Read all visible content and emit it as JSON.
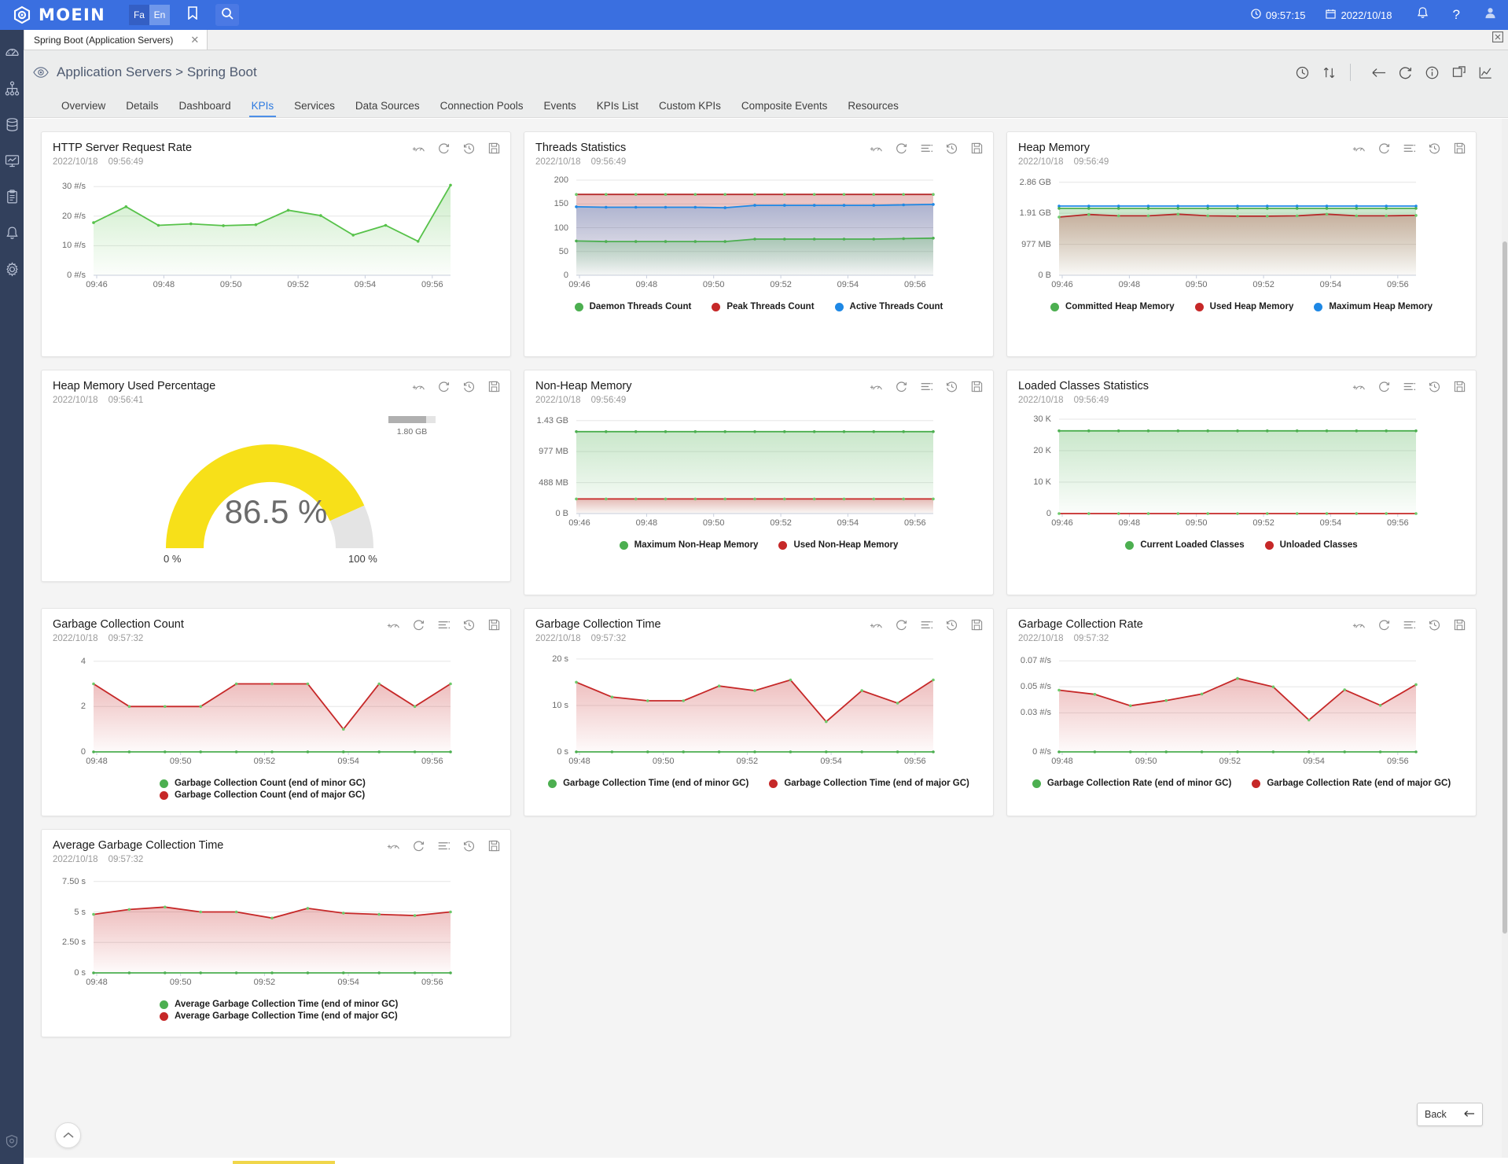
{
  "topbar": {
    "brand": "MOEIN",
    "lang_fa": "Fa",
    "lang_en": "En",
    "bookmark_icon": "bookmark-icon",
    "search_icon": "search-icon",
    "clock_time": "09:57:15",
    "calendar_date": "2022/10/18",
    "bell_icon": "bell-icon",
    "help_label": "?",
    "user_icon": "user-icon",
    "accent": "#3a6fe0"
  },
  "sidebar": {
    "items": [
      {
        "icon": "gauge-icon",
        "name": "sidebar-item-dashboard"
      },
      {
        "icon": "topology-icon",
        "name": "sidebar-item-topology"
      },
      {
        "icon": "database-icon",
        "name": "sidebar-item-database"
      },
      {
        "icon": "monitor-chart-icon",
        "name": "sidebar-item-monitoring"
      },
      {
        "icon": "clipboard-icon",
        "name": "sidebar-item-reports"
      },
      {
        "icon": "bell-icon",
        "name": "sidebar-item-alerts"
      },
      {
        "icon": "gear-icon",
        "name": "sidebar-item-settings"
      }
    ],
    "bottom_icon": "shield-icon"
  },
  "doc_tab": {
    "label": "Spring Boot (Application Servers)",
    "close_icon": "close-icon"
  },
  "page": {
    "breadcrumb": "Application Servers > Spring Boot",
    "eye_icon": "eye-icon",
    "actions": [
      {
        "icon": "refresh-clock-icon",
        "name": "auto-refresh-button"
      },
      {
        "icon": "sort-icon",
        "name": "sort-button"
      },
      {
        "icon": "back-arrow-icon",
        "name": "navigate-back-button"
      },
      {
        "icon": "reload-icon",
        "name": "reload-button"
      },
      {
        "icon": "info-icon",
        "name": "info-button"
      },
      {
        "icon": "pin-icon",
        "name": "pin-button"
      },
      {
        "icon": "chart-icon",
        "name": "chart-view-button"
      }
    ]
  },
  "navtabs": {
    "items": [
      "Overview",
      "Details",
      "Dashboard",
      "KPIs",
      "Services",
      "Data Sources",
      "Connection Pools",
      "Events",
      "KPIs List",
      "Custom KPIs",
      "Composite Events",
      "Resources"
    ],
    "active": "KPIs"
  },
  "card_icons": {
    "add_gauge": "add-gauge-icon",
    "refresh": "refresh-icon",
    "list": "list-settings-icon",
    "history": "history-icon",
    "save": "save-icon"
  },
  "colors": {
    "green": "#4caf50",
    "green_line": "#57c24a",
    "red": "#c62828",
    "red_dark": "#b52b2b",
    "blue": "#1e88e5",
    "yellow": "#f7e019",
    "gauge_track": "#e4e4e4"
  },
  "footer": {
    "back_label": "Back",
    "back_arrow_icon": "arrow-left-icon",
    "scroll_top_icon": "chevron-up-icon"
  },
  "chart_data": [
    {
      "id": "http-server-request-rate",
      "type": "line",
      "title": "HTTP Server Request Rate",
      "date": "2022/10/18",
      "time": "09:56:49",
      "icon_count": 4,
      "ylabel": "",
      "xlabel": "",
      "ytick_labels": [
        "30 #/s",
        "20 #/s",
        "10 #/s",
        "0 #/s"
      ],
      "ytick_values": [
        30,
        20,
        10,
        0
      ],
      "ylim": [
        0,
        33
      ],
      "xtick_labels": [
        "09:46",
        "09:48",
        "09:50",
        "09:52",
        "09:54",
        "09:56"
      ],
      "grid": true,
      "legend": [],
      "series": [
        {
          "name": "HTTP Server Request Rate",
          "color": "#57c24a",
          "fill": true,
          "values": [
            17.8,
            23.2,
            16.9,
            17.4,
            16.8,
            17.1,
            22.0,
            20.2,
            13.6,
            16.9,
            11.5,
            30.5
          ]
        }
      ]
    },
    {
      "id": "threads-statistics",
      "type": "line",
      "title": "Threads Statistics",
      "date": "2022/10/18",
      "time": "09:56:49",
      "icon_count": 5,
      "ytick_labels": [
        "200",
        "150",
        "100",
        "50",
        "0"
      ],
      "ytick_values": [
        200,
        150,
        100,
        50,
        0
      ],
      "ylim": [
        0,
        205
      ],
      "xtick_labels": [
        "09:46",
        "09:48",
        "09:50",
        "09:52",
        "09:54",
        "09:56"
      ],
      "grid": true,
      "legend": [
        {
          "label": "Daemon Threads Count",
          "color": "#4caf50"
        },
        {
          "label": "Peak Threads Count",
          "color": "#c62828"
        },
        {
          "label": "Active Threads Count",
          "color": "#1e88e5"
        }
      ],
      "series": [
        {
          "name": "Peak Threads Count",
          "color": "#b52b2b",
          "fill": true,
          "values": [
            170,
            170,
            170,
            170,
            170,
            170,
            170,
            170,
            170,
            170,
            170,
            170,
            170
          ]
        },
        {
          "name": "Active Threads Count",
          "color": "#1e88e5",
          "fill": true,
          "values": [
            144,
            143,
            143,
            143,
            143,
            142,
            147,
            147,
            147,
            147,
            147,
            148,
            149
          ]
        },
        {
          "name": "Daemon Threads Count",
          "color": "#4caf50",
          "fill": true,
          "values": [
            72,
            71,
            71,
            71,
            71,
            71,
            76,
            76,
            76,
            76,
            76,
            77,
            78
          ]
        }
      ]
    },
    {
      "id": "heap-memory",
      "type": "line",
      "title": "Heap Memory",
      "date": "2022/10/18",
      "time": "09:56:49",
      "icon_count": 5,
      "ytick_labels": [
        "2.86 GB",
        "1.91 GB",
        "977 MB",
        "0 B"
      ],
      "ytick_values": [
        2.86,
        1.91,
        0.954,
        0
      ],
      "ylim": [
        0,
        3.0
      ],
      "xtick_labels": [
        "09:46",
        "09:48",
        "09:50",
        "09:52",
        "09:54",
        "09:56"
      ],
      "grid": true,
      "legend": [
        {
          "label": "Committed Heap Memory",
          "color": "#4caf50"
        },
        {
          "label": "Used Heap Memory",
          "color": "#c62828"
        },
        {
          "label": "Maximum Heap Memory",
          "color": "#1e88e5"
        }
      ],
      "series": [
        {
          "name": "Maximum Heap Memory",
          "color": "#1e88e5",
          "fill": false,
          "values": [
            2.13,
            2.13,
            2.13,
            2.13,
            2.13,
            2.13,
            2.13,
            2.13,
            2.13,
            2.13,
            2.13,
            2.13,
            2.13
          ]
        },
        {
          "name": "Committed Heap Memory",
          "color": "#4caf50",
          "fill": true,
          "values": [
            2.06,
            2.06,
            2.06,
            2.06,
            2.06,
            2.06,
            2.06,
            2.06,
            2.06,
            2.06,
            2.06,
            2.06,
            2.06
          ]
        },
        {
          "name": "Used Heap Memory",
          "color": "#b52b2b",
          "fill": true,
          "values": [
            1.79,
            1.87,
            1.83,
            1.83,
            1.88,
            1.83,
            1.82,
            1.82,
            1.83,
            1.88,
            1.83,
            1.83,
            1.84
          ]
        }
      ]
    },
    {
      "id": "heap-memory-used-percentage",
      "type": "gauge",
      "title": "Heap Memory Used Percentage",
      "date": "2022/10/18",
      "time": "09:56:41",
      "icon_count": 4,
      "value": 86.5,
      "value_label": "86.5 %",
      "min_label": "0 %",
      "max_label": "100 %",
      "badge_label": "1.80 GB",
      "badge_fraction": 0.8,
      "color": "#f7e019",
      "track_color": "#e4e4e4"
    },
    {
      "id": "non-heap-memory",
      "type": "line",
      "title": "Non-Heap Memory",
      "date": "2022/10/18",
      "time": "09:56:49",
      "icon_count": 5,
      "ytick_labels": [
        "1.43 GB",
        "977 MB",
        "488 MB",
        "0 B"
      ],
      "ytick_values": [
        1.43,
        0.954,
        0.477,
        0
      ],
      "ylim": [
        0,
        1.5
      ],
      "xtick_labels": [
        "09:46",
        "09:48",
        "09:50",
        "09:52",
        "09:54",
        "09:56"
      ],
      "grid": true,
      "legend": [
        {
          "label": "Maximum Non-Heap Memory",
          "color": "#4caf50"
        },
        {
          "label": "Used Non-Heap Memory",
          "color": "#c62828"
        }
      ],
      "series": [
        {
          "name": "Maximum Non-Heap Memory",
          "color": "#4caf50",
          "fill": true,
          "values": [
            1.26,
            1.26,
            1.26,
            1.26,
            1.26,
            1.26,
            1.26,
            1.26,
            1.26,
            1.26,
            1.26,
            1.26,
            1.26
          ]
        },
        {
          "name": "Used Non-Heap Memory",
          "color": "#c62828",
          "fill": true,
          "values": [
            0.225,
            0.225,
            0.225,
            0.225,
            0.225,
            0.225,
            0.225,
            0.225,
            0.225,
            0.225,
            0.225,
            0.225,
            0.225
          ]
        }
      ]
    },
    {
      "id": "loaded-classes-statistics",
      "type": "line",
      "title": "Loaded Classes Statistics",
      "date": "2022/10/18",
      "time": "09:56:49",
      "icon_count": 5,
      "ytick_labels": [
        "30 K",
        "20 K",
        "10 K",
        "0"
      ],
      "ytick_values": [
        30000,
        20000,
        10000,
        0
      ],
      "ylim": [
        0,
        31000
      ],
      "xtick_labels": [
        "09:46",
        "09:48",
        "09:50",
        "09:52",
        "09:54",
        "09:56"
      ],
      "grid": true,
      "legend": [
        {
          "label": "Current Loaded Classes",
          "color": "#4caf50"
        },
        {
          "label": "Unloaded Classes",
          "color": "#c62828"
        }
      ],
      "series": [
        {
          "name": "Current Loaded Classes",
          "color": "#4caf50",
          "fill": true,
          "values": [
            26300,
            26300,
            26300,
            26300,
            26300,
            26300,
            26300,
            26300,
            26300,
            26300,
            26300,
            26300,
            26300
          ]
        },
        {
          "name": "Unloaded Classes",
          "color": "#c62828",
          "fill": false,
          "values": [
            0,
            0,
            0,
            0,
            0,
            0,
            0,
            0,
            0,
            0,
            0,
            0,
            0
          ]
        }
      ]
    },
    {
      "id": "garbage-collection-count",
      "type": "line",
      "title": "Garbage Collection Count",
      "date": "2022/10/18",
      "time": "09:57:32",
      "icon_count": 5,
      "ytick_labels": [
        "4",
        "2",
        "0"
      ],
      "ytick_values": [
        4,
        2,
        0
      ],
      "ylim": [
        0,
        4.3
      ],
      "xtick_labels": [
        "09:48",
        "09:50",
        "09:52",
        "09:54",
        "09:56"
      ],
      "grid": true,
      "legend": [
        {
          "label": "Garbage Collection Count (end of minor GC)",
          "color": "#4caf50"
        },
        {
          "label": "Garbage Collection Count (end of major GC)",
          "color": "#c62828"
        }
      ],
      "legend_stacked": true,
      "series": [
        {
          "name": "Garbage Collection Count (end of major GC)",
          "color": "#c62828",
          "fill": true,
          "values": [
            3,
            2,
            2,
            2,
            3,
            3,
            3,
            1,
            3,
            2,
            3
          ]
        },
        {
          "name": "Garbage Collection Count (end of minor GC)",
          "color": "#4caf50",
          "fill": false,
          "values": [
            0,
            0,
            0,
            0,
            0,
            0,
            0,
            0,
            0,
            0,
            0
          ]
        }
      ]
    },
    {
      "id": "garbage-collection-time",
      "type": "line",
      "title": "Garbage Collection Time",
      "date": "2022/10/18",
      "time": "09:57:32",
      "icon_count": 5,
      "ytick_labels": [
        "20 s",
        "10 s",
        "0 s"
      ],
      "ytick_values": [
        20,
        10,
        0
      ],
      "ylim": [
        0,
        21
      ],
      "xtick_labels": [
        "09:48",
        "09:50",
        "09:52",
        "09:54",
        "09:56"
      ],
      "grid": true,
      "legend": [
        {
          "label": "Garbage Collection Time (end of minor GC)",
          "color": "#4caf50"
        },
        {
          "label": "Garbage Collection Time (end of major GC)",
          "color": "#c62828"
        }
      ],
      "series": [
        {
          "name": "Garbage Collection Time (end of major GC)",
          "color": "#c62828",
          "fill": true,
          "values": [
            15.0,
            11.8,
            11.0,
            11.0,
            14.2,
            13.2,
            15.5,
            6.5,
            13.2,
            10.5,
            15.5
          ]
        },
        {
          "name": "Garbage Collection Time (end of minor GC)",
          "color": "#4caf50",
          "fill": false,
          "values": [
            0,
            0,
            0,
            0,
            0,
            0,
            0,
            0,
            0,
            0,
            0
          ]
        }
      ]
    },
    {
      "id": "garbage-collection-rate",
      "type": "line",
      "title": "Garbage Collection Rate",
      "date": "2022/10/18",
      "time": "09:57:32",
      "icon_count": 5,
      "ytick_labels": [
        "0.07 #/s",
        "0.05 #/s",
        "0.03 #/s",
        "0 #/s"
      ],
      "ytick_values": [
        0.07,
        0.05,
        0.03,
        0
      ],
      "ylim": [
        0,
        0.075
      ],
      "xtick_labels": [
        "09:48",
        "09:50",
        "09:52",
        "09:54",
        "09:56"
      ],
      "grid": true,
      "legend": [
        {
          "label": "Garbage Collection Rate (end of minor GC)",
          "color": "#4caf50"
        },
        {
          "label": "Garbage Collection Rate (end of major GC)",
          "color": "#c62828"
        }
      ],
      "series": [
        {
          "name": "Garbage Collection Rate (end of major GC)",
          "color": "#c62828",
          "fill": true,
          "values": [
            0.0475,
            0.0443,
            0.0355,
            0.0395,
            0.0445,
            0.0565,
            0.05,
            0.0245,
            0.0478,
            0.0358,
            0.0518
          ]
        },
        {
          "name": "Garbage Collection Rate (end of minor GC)",
          "color": "#4caf50",
          "fill": false,
          "values": [
            0,
            0,
            0,
            0,
            0,
            0,
            0,
            0,
            0,
            0,
            0
          ]
        }
      ]
    },
    {
      "id": "average-garbage-collection-time",
      "type": "line",
      "title": "Average Garbage Collection Time",
      "date": "2022/10/18",
      "time": "09:57:32",
      "icon_count": 5,
      "ytick_labels": [
        "7.50 s",
        "5 s",
        "2.50 s",
        "0 s"
      ],
      "ytick_values": [
        7.5,
        5,
        2.5,
        0
      ],
      "ylim": [
        0,
        8
      ],
      "xtick_labels": [
        "09:48",
        "09:50",
        "09:52",
        "09:54",
        "09:56"
      ],
      "grid": true,
      "legend": [
        {
          "label": "Average Garbage Collection Time (end of minor GC)",
          "color": "#4caf50"
        },
        {
          "label": "Average Garbage Collection Time (end of major GC)",
          "color": "#c62828"
        }
      ],
      "legend_stacked": true,
      "series": [
        {
          "name": "Average Garbage Collection Time (end of major GC)",
          "color": "#c62828",
          "fill": true,
          "values": [
            4.8,
            5.2,
            5.4,
            5.0,
            5.0,
            4.5,
            5.3,
            4.9,
            4.8,
            4.7,
            5.0
          ]
        },
        {
          "name": "Average Garbage Collection Time (end of minor GC)",
          "color": "#4caf50",
          "fill": false,
          "values": [
            0,
            0,
            0,
            0,
            0,
            0,
            0,
            0,
            0,
            0,
            0
          ]
        }
      ]
    }
  ]
}
